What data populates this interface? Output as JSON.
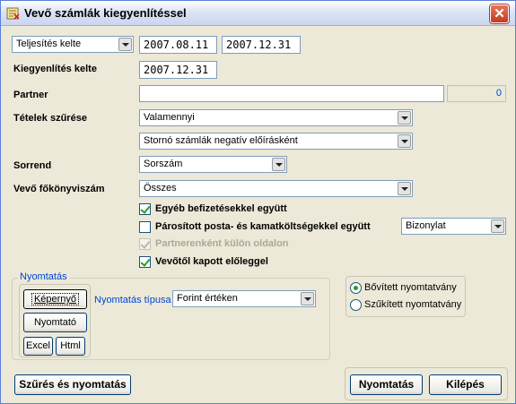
{
  "window": {
    "title": "Vevő számlák kiegyenlítéssel",
    "close_glyph": "✕"
  },
  "filters": {
    "date_type": "Teljesítés kelte",
    "date_from": "2007.08.11",
    "date_to": "2007.12.31",
    "settlement_label": "Kiegyenlítés kelte",
    "settlement_date": "2007.12.31",
    "partner_label": "Partner",
    "partner_value": "",
    "partner_count": "0",
    "items_filter_label": "Tételek szűrése",
    "items_filter_value": "Valamennyi",
    "storno_value": "Stornó számlák negatív előírásként",
    "sort_label": "Sorrend",
    "sort_value": "Sorszám",
    "ledger_label": "Vevő főkönyviszám",
    "ledger_value": "Összes"
  },
  "options": {
    "other_payments": {
      "label": "Egyéb befizetésekkel együtt",
      "checked": true
    },
    "paired_costs": {
      "label": "Párosított posta- és kamatköltségekkel együtt",
      "checked": false
    },
    "paired_select": "Bizonylat",
    "per_partner": {
      "label": "Partnerenként külön oldalon",
      "checked": true,
      "disabled": true
    },
    "advance": {
      "label": "Vevőtől kapott előleggel",
      "checked": true
    }
  },
  "printing": {
    "group_title": "Nyomtatás",
    "screen_button": "Képernyő",
    "printer_button": "Nyomtató",
    "excel_button": "Excel",
    "html_button": "Html",
    "type_label": "Nyomtatás típusa",
    "type_value": "Forint értéken"
  },
  "format": {
    "extended": "Bővített nyomtatvány",
    "narrowed": "Szűkített nyomtatvány",
    "selected": "extended"
  },
  "actions": {
    "filter_print": "Szűrés és nyomtatás",
    "print": "Nyomtatás",
    "exit": "Kilépés"
  }
}
